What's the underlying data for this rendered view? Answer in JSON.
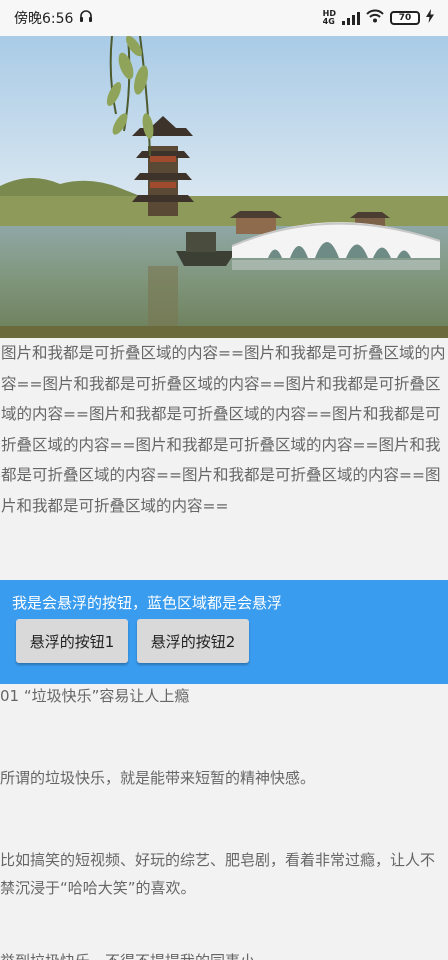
{
  "status_bar": {
    "time": "傍晚6:56",
    "network": "HD 4G",
    "battery": "70"
  },
  "collapsible": {
    "text": "图片和我都是可折叠区域的内容==图片和我都是可折叠区域的内容==图片和我都是可折叠区域的内容==图片和我都是可折叠区域的内容==图片和我都是可折叠区域的内容==图片和我都是可折叠区域的内容==图片和我都是可折叠区域的内容==图片和我都是可折叠区域的内容==图片和我都是可折叠区域的内容==图片和我都是可折叠区域的内容=="
  },
  "floating": {
    "title": "我是会悬浮的按钮，蓝色区域都是会悬浮",
    "button1": "悬浮的按钮1",
    "button2": "悬浮的按钮2",
    "color": "#3a9cef"
  },
  "article": {
    "heading": "01 “垃圾快乐”容易让人上瘾",
    "p1": "所谓的垃圾快乐，就是能带来短暂的精神快感。",
    "p2": "比如搞笑的短视频、好玩的综艺、肥皂剧，看着非常过瘾，让人不禁沉浸于“哈哈大笑”的喜欢。",
    "p3": "举到垃圾快乐，不得不提提我的同事小"
  }
}
